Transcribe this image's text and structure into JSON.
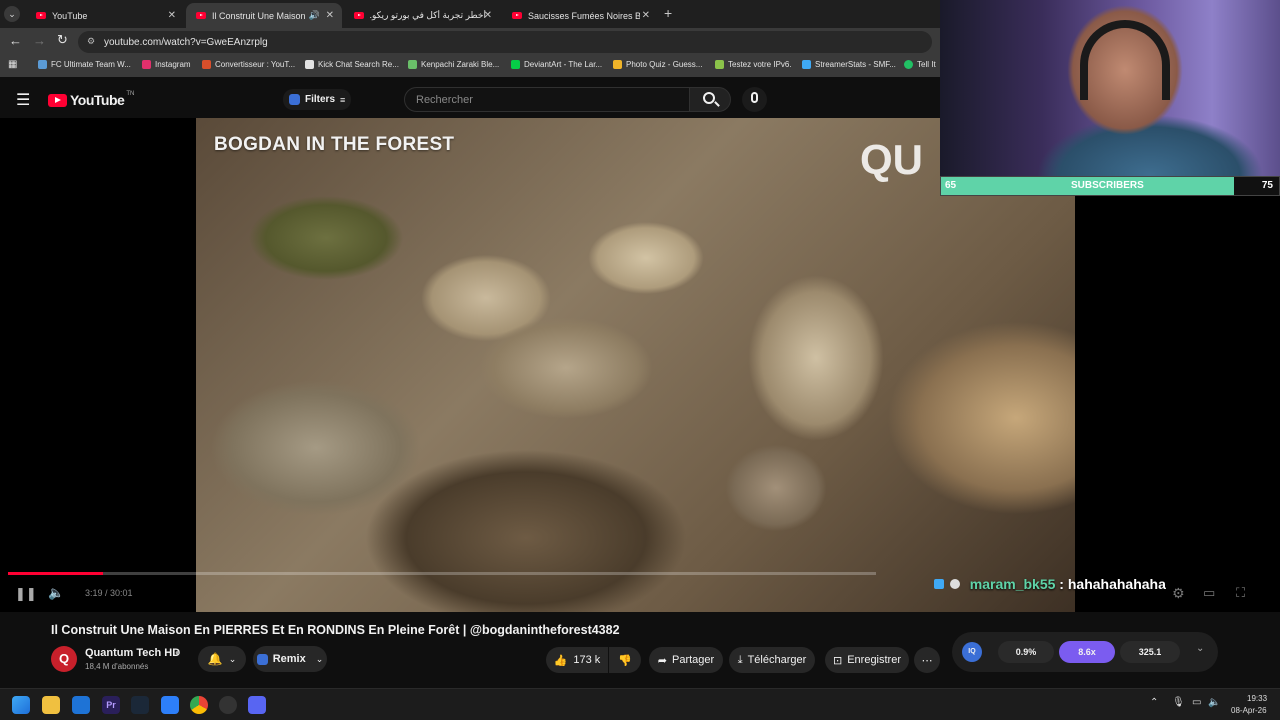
{
  "browser": {
    "tabs": [
      {
        "title": "YouTube",
        "active": false,
        "audio": false
      },
      {
        "title": "Il Construit Une Maison En",
        "active": true,
        "audio": true
      },
      {
        "title": "أخطر تجربة أكل في بورتو ريكو...",
        "active": false,
        "audio": false
      },
      {
        "title": "Saucisses Fumées Noires Bushc",
        "active": false,
        "audio": false
      }
    ],
    "url": "youtube.com/watch?v=GweEAnzrplg",
    "bookmarks": [
      {
        "label": "FC Ultimate Team W...",
        "color": "#5b9bd5"
      },
      {
        "label": "Instagram",
        "color": "#e1306c"
      },
      {
        "label": "Convertisseur : YouT...",
        "color": "#d94f2b"
      },
      {
        "label": "Kick Chat Search Re...",
        "color": "#e3e3e3"
      },
      {
        "label": "Kenpachi Zaraki Ble...",
        "color": "#6abf69"
      },
      {
        "label": "DeviantArt - The Lar...",
        "color": "#05cc47"
      },
      {
        "label": "Photo Quiz - Guess...",
        "color": "#f0b429"
      },
      {
        "label": "Testez votre IPv6.",
        "color": "#8bc34a"
      },
      {
        "label": "StreamerStats - SMF...",
        "color": "#3fa9f5"
      },
      {
        "label": "Tell It",
        "color": "#21c064"
      }
    ]
  },
  "youtube": {
    "logo_text": "YouTube",
    "logo_sup": "TN",
    "filters_label": "Filters",
    "search_placeholder": "Rechercher"
  },
  "video": {
    "overlay_title": "BOGDAN IN THE FOREST",
    "watermark": "QU",
    "time": "3:19 / 30:01",
    "progress": 0.11
  },
  "stream": {
    "subs_current": "65",
    "subs_label": "SUBSCRIBERS",
    "subs_goal": "75",
    "subs_fraction": 0.867,
    "chat_user": "maram_bk55",
    "chat_sep": " : ",
    "chat_text": "hahahahahaha"
  },
  "info": {
    "title": "Il Construit Une Maison En PIERRES Et En RONDINS En Pleine Forêt | @bogdanintheforest4382",
    "channel_name": "Quantum Tech HD",
    "subscribers": "18,4 M d'abonnés",
    "remix_label": "Remix",
    "likes": "173 k",
    "share_label": "Partager",
    "download_label": "Télécharger",
    "save_label": "Enregistrer",
    "widget": {
      "v1": "0.9%",
      "v2": "8.6x",
      "v3": "325.1"
    }
  },
  "taskbar": {
    "time": "19:33",
    "date": "08-Apr-26"
  },
  "colors": {
    "accent_red": "#ff0033",
    "subs_green": "#5fd3a8",
    "chat_user_green": "#5fd3a8",
    "widget_purple": "#7b5cf0"
  }
}
